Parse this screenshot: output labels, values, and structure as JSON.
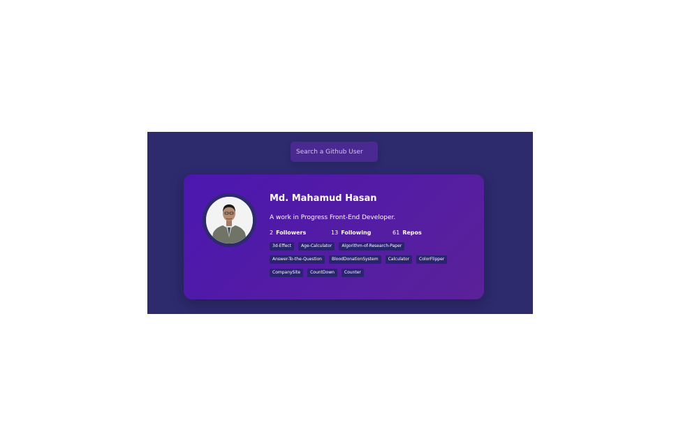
{
  "search": {
    "placeholder": "Search a Github User",
    "value": ""
  },
  "profile": {
    "name": "Md. Mahamud Hasan",
    "bio": "A work in Progress Front-End Developer.",
    "stats": [
      {
        "value": "2",
        "label": "Followers"
      },
      {
        "value": "13",
        "label": "Following"
      },
      {
        "value": "61",
        "label": "Repos"
      }
    ],
    "repos": [
      "3d-Effect",
      "Age-Calculator",
      "Algorithm-of-Research-Paper",
      "Answer-To-the-Question",
      "BloodDonationSystem",
      "Calculator",
      "ColorFlipper",
      "CompanySite",
      "CountDown",
      "Counter"
    ]
  },
  "colors": {
    "background": "#2d2a6e",
    "card_start": "#4b17b0",
    "card_end": "#5b2199",
    "repo_chip": "#2a2470",
    "search_bg": "#4a2a90"
  }
}
